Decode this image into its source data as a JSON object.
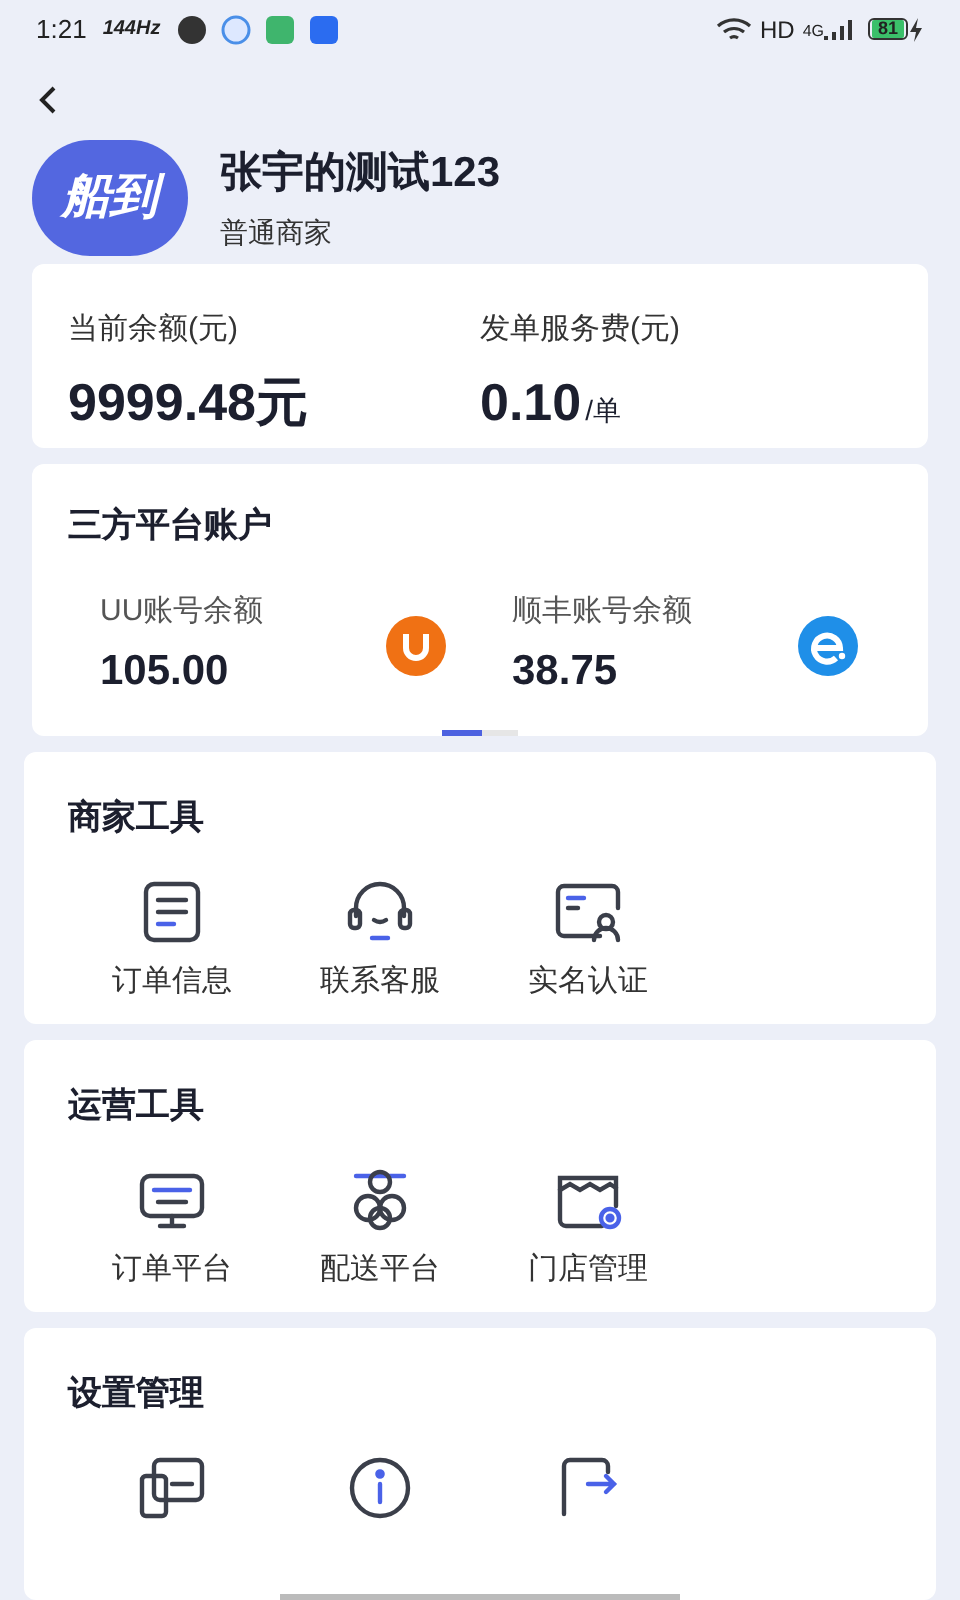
{
  "status_bar": {
    "time": "1:21",
    "refresh_rate": "144Hz",
    "network": "HD",
    "signal_type": "4G",
    "battery": "81"
  },
  "profile": {
    "logo": "船到",
    "name": "张宇的测试123",
    "role": "普通商家"
  },
  "balance": [
    {
      "label": "当前余额(元)",
      "value": "9999.48元"
    },
    {
      "label": "发单服务费(元)",
      "value": "0.10",
      "unit": "/单"
    }
  ],
  "third_party": {
    "title": "三方平台账户",
    "accounts": [
      {
        "label": "UU账号余额",
        "value": "105.00",
        "kind": "uu",
        "color": "#f07114"
      },
      {
        "label": "顺丰账号余额",
        "value": "38.75",
        "kind": "sf",
        "color": "#1f8fe8"
      }
    ],
    "pages": [
      {
        "selected": true
      },
      {
        "selected": false
      }
    ]
  },
  "sections": [
    {
      "title": "商家工具",
      "items": [
        {
          "label": "订单信息",
          "kind": "order"
        },
        {
          "label": "联系客服",
          "kind": "headset"
        },
        {
          "label": "实名认证",
          "kind": "idcard"
        }
      ]
    },
    {
      "title": "运营工具",
      "items": [
        {
          "label": "订单平台",
          "kind": "monitor"
        },
        {
          "label": "配送平台",
          "kind": "courier"
        },
        {
          "label": "门店管理",
          "kind": "store"
        }
      ]
    },
    {
      "title": "设置管理",
      "items": [
        {
          "kind": "card"
        },
        {
          "kind": "info"
        },
        {
          "kind": "export"
        }
      ]
    }
  ]
}
